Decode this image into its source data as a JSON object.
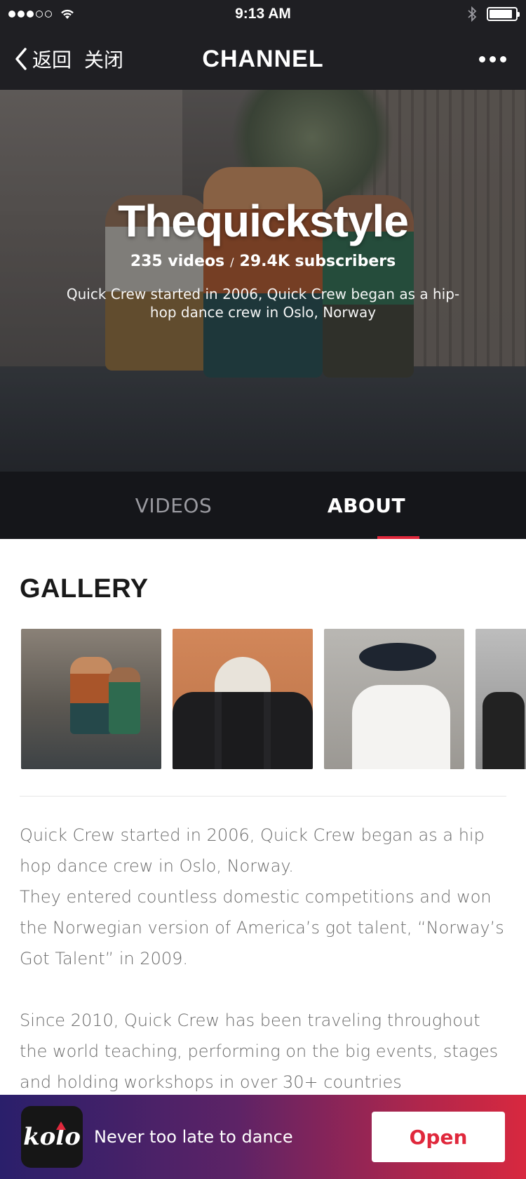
{
  "status_bar": {
    "time": "9:13 AM",
    "signal_strength": "3 of 5",
    "battery_level": 0.9
  },
  "nav": {
    "back_label": "返回",
    "close_label": "关闭",
    "title": "CHANNEL",
    "icons": {
      "back": "chevron-left-icon",
      "more": "more-horizontal-icon"
    }
  },
  "hero": {
    "channel_name": "Thequickstyle",
    "videos": "235 videos",
    "separator": "/",
    "subscribers": "29.4K subscribers",
    "description": "Quick Crew started in 2006, Quick Crew began as a hip-hop dance crew in Oslo, Norway"
  },
  "tabs": [
    {
      "label": "VIDEOS",
      "active": false
    },
    {
      "label": "ABOUT",
      "active": true
    }
  ],
  "gallery": {
    "title": "GALLERY",
    "thumbnails": [
      "crew-squat-photo",
      "crew-adidas-photo",
      "man-phone-photo",
      "man-wall-photo"
    ]
  },
  "about": {
    "paragraph1_line1": "Quick Crew started in 2006, Quick Crew began as a hip hop dance crew in Oslo, Norway.",
    "paragraph1_line2": "They entered countless domestic competitions and won the Norwegian version of America’s got talent, “Norway’s Got Talent” in 2009.",
    "paragraph2": "Since 2010, Quick Crew has been traveling throughout the world teaching, performing on the big events, stages and holding workshops in over 30+ countries"
  },
  "banner": {
    "logo_text": "kolo",
    "tagline": "Never too late to dance",
    "open_label": "Open"
  },
  "colors": {
    "accent": "#e0283c",
    "nav_bg": "#1f1f23",
    "tab_bg": "#15161a"
  }
}
